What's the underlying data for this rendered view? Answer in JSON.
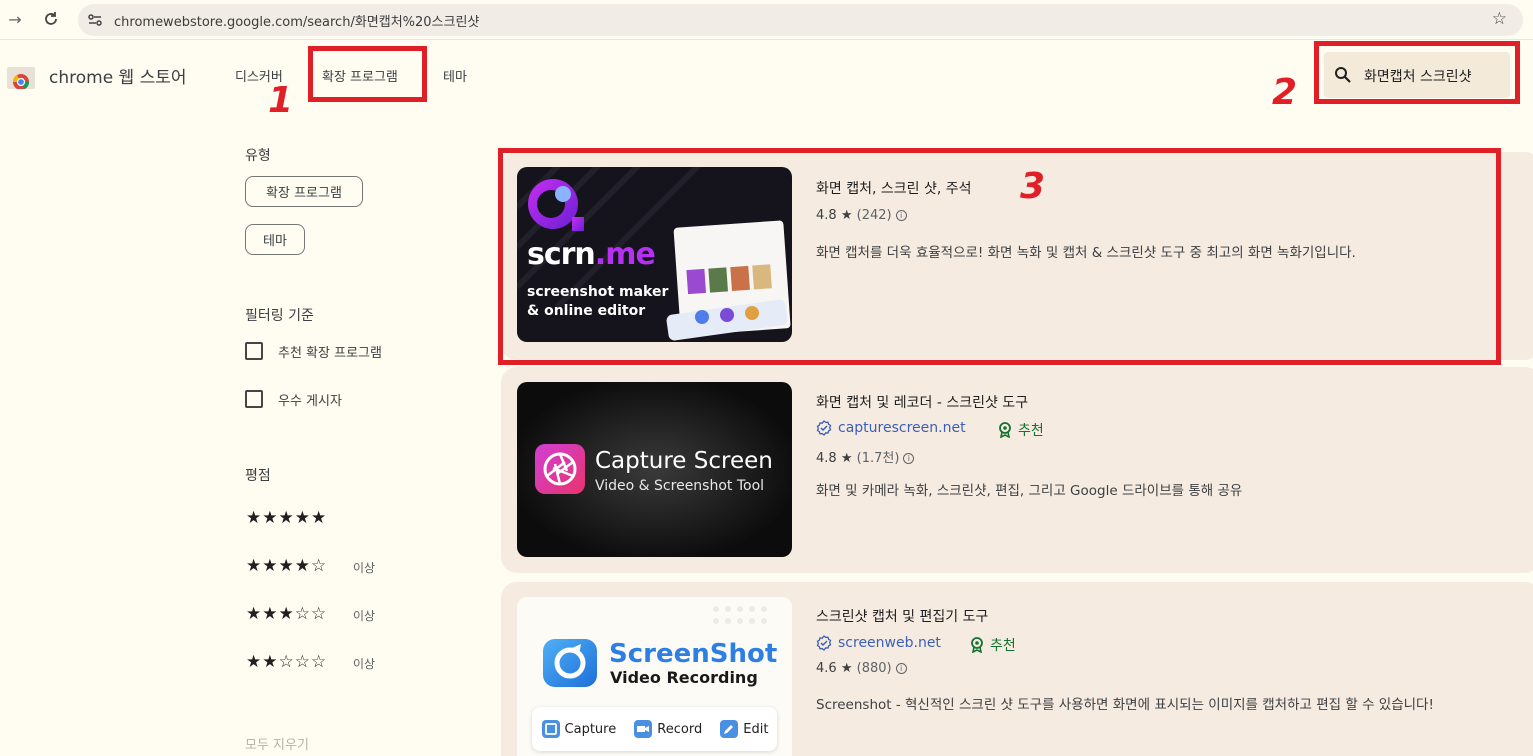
{
  "browser": {
    "url": "chromewebstore.google.com/search/화면캡처%20스크린샷"
  },
  "store": {
    "brand": "chrome 웹 스토어",
    "nav": [
      "디스커버",
      "확장 프로그램",
      "테마"
    ],
    "search_query": "화면캡처 스크린샷"
  },
  "annotations": [
    "1",
    "2",
    "3"
  ],
  "sidebar": {
    "type_heading": "유형",
    "type_chips": [
      "확장 프로그램",
      "테마"
    ],
    "filter_heading": "필터링 기준",
    "filters": [
      "추천 확장 프로그램",
      "우수 게시자"
    ],
    "rating_heading": "평점",
    "ratings": [
      {
        "stars": "★★★★★",
        "suffix": ""
      },
      {
        "stars": "★★★★☆",
        "suffix": "이상"
      },
      {
        "stars": "★★★☆☆",
        "suffix": "이상"
      },
      {
        "stars": "★★☆☆☆",
        "suffix": "이상"
      }
    ],
    "clear": "모두 지우기"
  },
  "results": [
    {
      "title": "화면 캡처, 스크린 샷, 주석",
      "rating": "4.8",
      "count": "(242)",
      "description": "화면 캡처를 더욱 효율적으로! 화면 녹화 및 캡처 & 스크린샷 도구 중 최고의 화면 녹화기입니다.",
      "thumb": {
        "brand": "scrn",
        "brand_accent": ".me",
        "line1": "screenshot maker",
        "line2": "& online editor"
      }
    },
    {
      "title": "화면 캡처 및 레코더 - 스크린샷 도구",
      "publisher": "capturescreen.net",
      "badge": "추천",
      "rating": "4.8",
      "count": "(1.7천)",
      "description": "화면 및 카메라 녹화, 스크린샷, 편집, 그리고 Google 드라이브를 통해 공유",
      "thumb": {
        "title": "Capture Screen",
        "subtitle": "Video & Screenshot Tool"
      }
    },
    {
      "title": "스크린샷 캡처 및 편집기 도구",
      "publisher": "screenweb.net",
      "badge": "추천",
      "rating": "4.6",
      "count": "(880)",
      "description": "Screenshot - 혁신적인 스크린 샷 도구를 사용하면 화면에 표시되는 이미지를 캡처하고 편집 할 수 있습니다!",
      "thumb": {
        "title": "ScreenShot",
        "subtitle": "Video Recording",
        "buttons": [
          "Capture",
          "Record",
          "Edit"
        ]
      }
    }
  ],
  "colors": {
    "background": "#fffcf1",
    "card": "#f6ebe0",
    "annotation_red": "#e01f27",
    "link_blue": "#3b5fb8",
    "badge_green": "#137333"
  }
}
